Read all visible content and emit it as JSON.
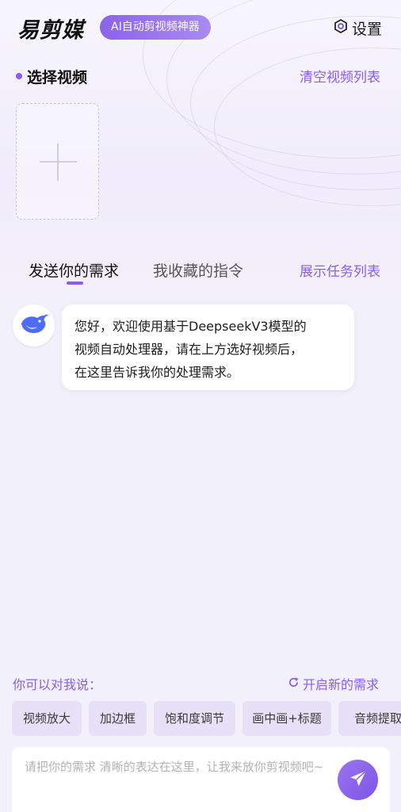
{
  "header": {
    "logo": "易剪媒",
    "slogan": "AI自动剪视频神器",
    "settings_label": "设置"
  },
  "video_section": {
    "title": "选择视频",
    "clear_label": "清空视频列表"
  },
  "tabs": {
    "items": [
      {
        "label": "发送你的需求",
        "active": true
      },
      {
        "label": "我收藏的指令",
        "active": false
      }
    ],
    "task_list_label": "展示任务列表"
  },
  "chat": {
    "messages": [
      {
        "sender": "assistant",
        "lines": [
          "您好，欢迎使用基于DeepseekV3模型的",
          "视频自动处理器，请在上方选好视频后，",
          "在这里告诉我你的处理需求。"
        ]
      }
    ]
  },
  "suggestions": {
    "title": "你可以对我说：",
    "new_request_label": "开启新的需求",
    "chips": [
      "视频放大",
      "加边框",
      "饱和度调节",
      "画中画+标题",
      "音频提取"
    ]
  },
  "input": {
    "placeholder": "请把你的需求 清晰的表达在这里，让我来放你剪视频吧~",
    "value": ""
  },
  "colors": {
    "accent": "#8a5cf0",
    "chip_bg": "#e6e1f6",
    "page_bg": "#f2f0fb"
  },
  "icons": {
    "settings": "hexagon-gear-icon",
    "avatar": "deepseek-whale-icon",
    "refresh": "refresh-icon",
    "send": "paper-plane-icon",
    "add": "plus-icon"
  }
}
